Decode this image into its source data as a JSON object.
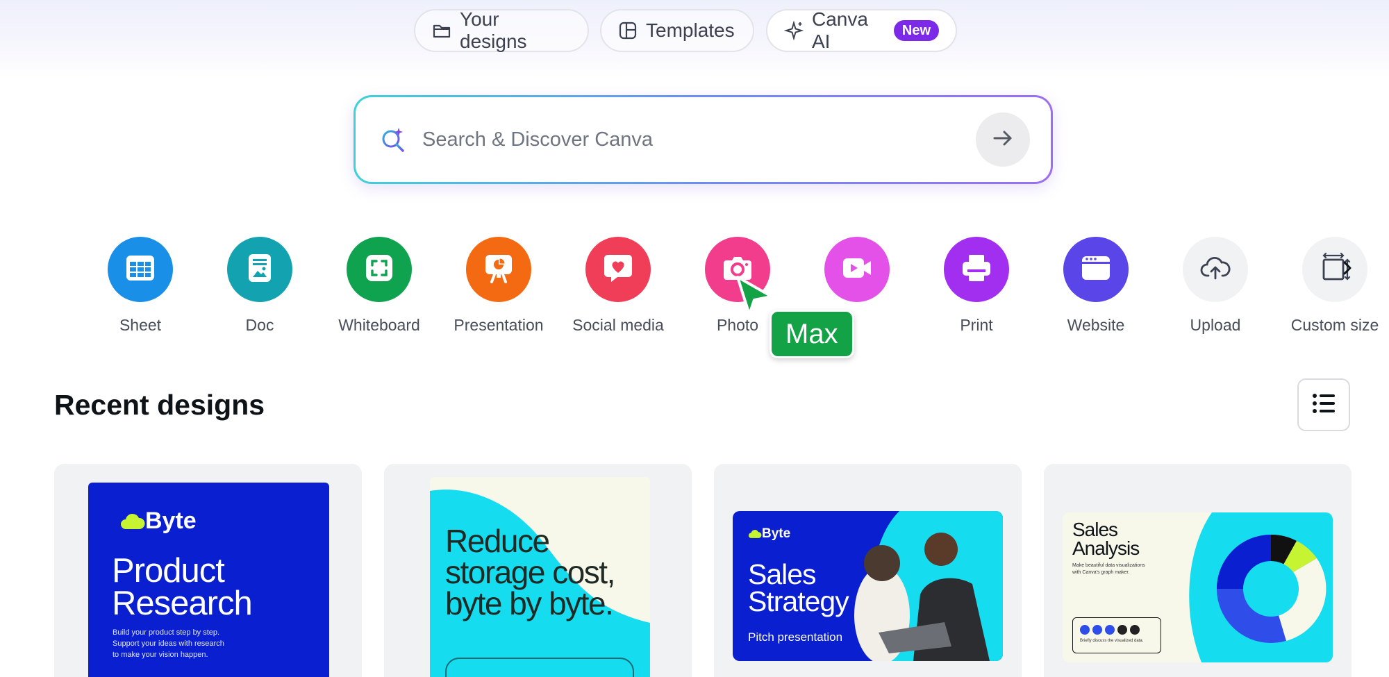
{
  "top_nav": {
    "your_designs": "Your designs",
    "templates": "Templates",
    "canva_ai": "Canva AI",
    "new_badge": "New"
  },
  "search": {
    "placeholder": "Search & Discover Canva"
  },
  "categories": [
    {
      "label": "Sheet",
      "color": "#1a8fe8",
      "icon": "sheet-icon"
    },
    {
      "label": "Doc",
      "color": "#13a3b0",
      "icon": "doc-icon"
    },
    {
      "label": "Whiteboard",
      "color": "#0fa34f",
      "icon": "whiteboard-icon"
    },
    {
      "label": "Presentation",
      "color": "#f46a12",
      "icon": "presentation-icon"
    },
    {
      "label": "Social media",
      "color": "#f03e58",
      "icon": "heart-icon"
    },
    {
      "label": "Photo",
      "color": "#f23c8c",
      "icon": "camera-icon"
    },
    {
      "label": "",
      "color": "#e451e8",
      "icon": "video-icon"
    },
    {
      "label": "Print",
      "color": "#a22ef0",
      "icon": "printer-icon"
    },
    {
      "label": "Website",
      "color": "#5a46e8",
      "icon": "website-icon"
    },
    {
      "label": "Upload",
      "color": "#f1f2f4",
      "icon": "cloud-upload-icon"
    },
    {
      "label": "Custom size",
      "color": "#f1f2f4",
      "icon": "custom-size-icon"
    }
  ],
  "cursor": {
    "name": "Max",
    "color": "#13a346"
  },
  "recent": {
    "title": "Recent designs"
  },
  "designs": [
    {
      "logo": "Byte",
      "title_line1": "Product",
      "title_line2": "Research",
      "body": [
        "Build your product step by step.",
        "Support your ideas  with research",
        "to make your vision happen."
      ]
    },
    {
      "headline": [
        "Reduce",
        "storage cost,",
        "byte by byte."
      ]
    },
    {
      "logo": "Byte",
      "title_line1": "Sales",
      "title_line2": "Strategy",
      "subtitle": "Pitch presentation"
    },
    {
      "title_line1": "Sales",
      "title_line2": "Analysis",
      "body": [
        "Make beautiful data visualizations",
        "with Canva's graph maker."
      ],
      "box_caption": "Briefly discuss the visualized data."
    }
  ]
}
